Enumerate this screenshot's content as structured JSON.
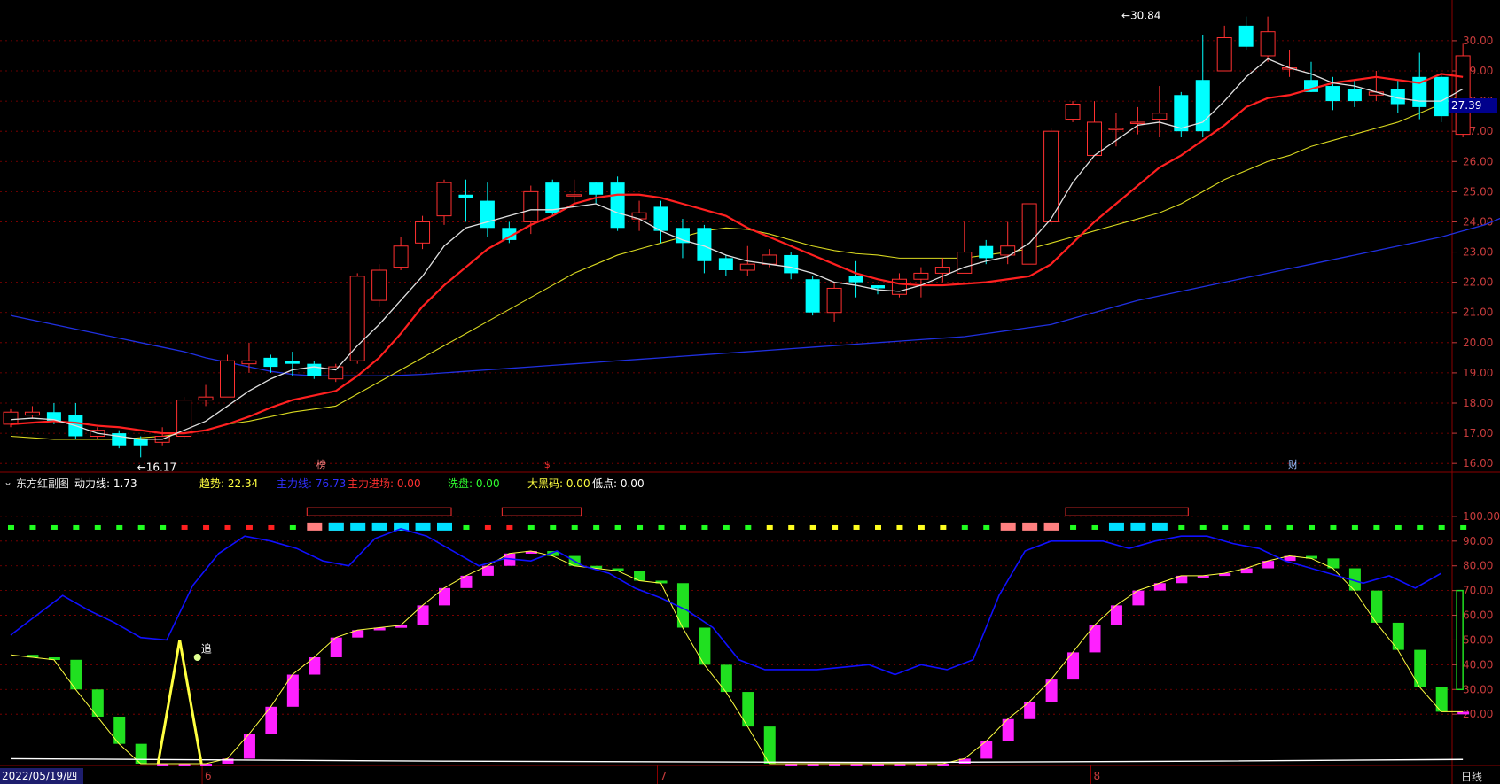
{
  "colors": {
    "up": "#ff3030",
    "down": "#00ffff",
    "ma5": "#e0e0e0",
    "ma10": "#ff2020",
    "ma20": "#d8d820",
    "ma60": "#2030e0",
    "grid": "#8b0000",
    "axis_text": "#c83c3c",
    "bar_magenta": "#ff20ff",
    "bar_green": "#20e020",
    "power_line": "#1010ff"
  },
  "chart_data": [
    {
      "type": "candlestick",
      "title": "",
      "ylim": [
        15.8,
        31.2
      ],
      "y_ticks": [
        "16.00",
        "17.00",
        "18.00",
        "19.00",
        "20.00",
        "21.00",
        "22.00",
        "23.00",
        "24.00",
        "25.00",
        "26.00",
        "27.00",
        "28.00",
        "29.00",
        "30.00"
      ],
      "month_ticks": [
        "6",
        "7",
        "8"
      ],
      "last_price": "27.39",
      "annotations": {
        "high": "30.84",
        "low": "16.17",
        "marker_top_1": "榜",
        "marker_top_2": "$",
        "marker_top_3": "财"
      },
      "candles": [
        [
          17.3,
          17.7,
          17.2,
          17.8
        ],
        [
          17.6,
          17.7,
          17.5,
          17.9
        ],
        [
          17.7,
          17.4,
          17.3,
          18.0
        ],
        [
          17.6,
          16.9,
          16.8,
          18.0
        ],
        [
          16.9,
          17.1,
          16.8,
          17.2
        ],
        [
          17.0,
          16.6,
          16.5,
          17.1
        ],
        [
          16.8,
          16.6,
          16.2,
          16.9
        ],
        [
          16.7,
          16.9,
          16.6,
          17.2
        ],
        [
          16.9,
          18.1,
          16.8,
          18.2
        ],
        [
          18.1,
          18.2,
          17.9,
          18.6
        ],
        [
          18.2,
          19.4,
          18.2,
          19.6
        ],
        [
          19.3,
          19.4,
          19.0,
          20.0
        ],
        [
          19.5,
          19.2,
          19.0,
          19.6
        ],
        [
          19.4,
          19.3,
          18.9,
          19.7
        ],
        [
          19.3,
          18.9,
          18.8,
          19.4
        ],
        [
          18.8,
          19.2,
          18.7,
          19.3
        ],
        [
          19.4,
          22.2,
          19.3,
          22.3
        ],
        [
          21.4,
          22.4,
          21.2,
          22.6
        ],
        [
          22.5,
          23.2,
          22.4,
          23.5
        ],
        [
          23.3,
          24.0,
          23.1,
          24.2
        ],
        [
          24.2,
          25.3,
          23.9,
          25.4
        ],
        [
          24.9,
          24.8,
          24.0,
          25.4
        ],
        [
          24.7,
          23.8,
          23.5,
          25.3
        ],
        [
          23.8,
          23.4,
          23.3,
          24.0
        ],
        [
          24.0,
          25.0,
          23.6,
          25.2
        ],
        [
          25.3,
          24.3,
          24.2,
          25.4
        ],
        [
          24.9,
          24.9,
          24.6,
          25.4
        ],
        [
          25.3,
          24.9,
          24.6,
          25.3
        ],
        [
          25.3,
          23.8,
          23.7,
          25.5
        ],
        [
          24.1,
          24.3,
          23.7,
          24.7
        ],
        [
          24.5,
          23.7,
          23.3,
          24.7
        ],
        [
          23.8,
          23.3,
          22.8,
          24.1
        ],
        [
          23.8,
          22.7,
          22.3,
          23.9
        ],
        [
          22.8,
          22.4,
          22.2,
          22.9
        ],
        [
          22.4,
          22.6,
          22.2,
          23.2
        ],
        [
          22.6,
          22.9,
          22.5,
          23.1
        ],
        [
          22.9,
          22.3,
          22.1,
          23.0
        ],
        [
          22.1,
          21.0,
          20.9,
          22.2
        ],
        [
          21.0,
          21.8,
          20.7,
          22.0
        ],
        [
          22.2,
          22.0,
          21.5,
          22.7
        ],
        [
          21.9,
          21.8,
          21.6,
          21.9
        ],
        [
          21.6,
          22.1,
          21.5,
          22.3
        ],
        [
          22.1,
          22.3,
          21.5,
          22.5
        ],
        [
          22.3,
          22.5,
          22.0,
          22.8
        ],
        [
          22.3,
          23.0,
          22.3,
          24.0
        ],
        [
          23.2,
          22.8,
          22.6,
          23.4
        ],
        [
          22.9,
          23.2,
          22.6,
          24.0
        ],
        [
          22.6,
          24.6,
          22.6,
          24.6
        ],
        [
          24.0,
          27.0,
          23.9,
          27.1
        ],
        [
          27.4,
          27.9,
          27.3,
          28.0
        ],
        [
          26.2,
          27.3,
          26.2,
          28.0
        ],
        [
          27.1,
          27.1,
          26.5,
          27.6
        ],
        [
          27.3,
          27.3,
          26.9,
          27.8
        ],
        [
          27.4,
          27.6,
          26.8,
          28.5
        ],
        [
          28.2,
          27.0,
          26.8,
          28.3
        ],
        [
          28.7,
          27.0,
          26.8,
          30.2
        ],
        [
          29.0,
          30.1,
          29.0,
          30.5
        ],
        [
          30.5,
          29.8,
          29.7,
          30.8
        ],
        [
          29.5,
          30.3,
          29.3,
          30.8
        ],
        [
          29.1,
          29.1,
          28.8,
          29.7
        ],
        [
          28.7,
          28.3,
          28.3,
          29.3
        ],
        [
          28.5,
          28.0,
          27.7,
          28.8
        ],
        [
          28.4,
          28.0,
          27.8,
          28.7
        ],
        [
          28.2,
          28.3,
          28.0,
          29.0
        ],
        [
          28.4,
          27.9,
          27.6,
          28.7
        ],
        [
          28.8,
          27.8,
          27.4,
          29.6
        ],
        [
          28.8,
          27.5,
          27.3,
          28.9
        ],
        [
          26.9,
          29.5,
          26.8,
          29.9
        ]
      ],
      "ma5": [
        17.45,
        17.5,
        17.45,
        17.25,
        17.0,
        16.9,
        16.8,
        16.8,
        17.1,
        17.4,
        17.9,
        18.4,
        18.8,
        19.1,
        19.2,
        19.1,
        19.9,
        20.6,
        21.4,
        22.2,
        23.2,
        23.8,
        24.0,
        24.2,
        24.4,
        24.4,
        24.5,
        24.6,
        24.3,
        24.1,
        23.7,
        23.4,
        23.2,
        22.9,
        22.7,
        22.6,
        22.5,
        22.3,
        22.0,
        21.9,
        21.75,
        21.7,
        21.9,
        22.2,
        22.5,
        22.7,
        22.85,
        23.3,
        24.1,
        25.3,
        26.2,
        26.7,
        27.2,
        27.3,
        27.1,
        27.3,
        28.0,
        28.8,
        29.4,
        29.1,
        28.9,
        28.6,
        28.5,
        28.3,
        28.1,
        28.0,
        28.0,
        28.4
      ],
      "ma10": [
        17.3,
        17.35,
        17.4,
        17.35,
        17.25,
        17.2,
        17.1,
        17.0,
        17.0,
        17.1,
        17.3,
        17.55,
        17.85,
        18.1,
        18.25,
        18.4,
        18.9,
        19.5,
        20.3,
        21.2,
        21.9,
        22.5,
        23.1,
        23.5,
        23.9,
        24.2,
        24.6,
        24.8,
        24.9,
        24.9,
        24.8,
        24.6,
        24.4,
        24.2,
        23.8,
        23.5,
        23.2,
        22.9,
        22.6,
        22.3,
        22.1,
        21.95,
        21.9,
        21.9,
        21.95,
        22.0,
        22.1,
        22.2,
        22.6,
        23.3,
        24.0,
        24.6,
        25.2,
        25.8,
        26.2,
        26.7,
        27.2,
        27.8,
        28.1,
        28.2,
        28.4,
        28.6,
        28.7,
        28.8,
        28.7,
        28.6,
        28.9,
        28.8
      ],
      "ma20": [
        16.9,
        16.85,
        16.8,
        16.8,
        16.8,
        16.8,
        16.85,
        16.9,
        17.0,
        17.1,
        17.3,
        17.4,
        17.55,
        17.7,
        17.8,
        17.9,
        18.3,
        18.7,
        19.1,
        19.5,
        19.9,
        20.3,
        20.7,
        21.1,
        21.5,
        21.9,
        22.3,
        22.6,
        22.9,
        23.1,
        23.3,
        23.5,
        23.7,
        23.8,
        23.75,
        23.6,
        23.4,
        23.2,
        23.05,
        22.95,
        22.9,
        22.8,
        22.8,
        22.8,
        22.8,
        22.9,
        23.0,
        23.1,
        23.3,
        23.5,
        23.7,
        23.9,
        24.1,
        24.3,
        24.6,
        25.0,
        25.4,
        25.7,
        26.0,
        26.2,
        26.5,
        26.7,
        26.9,
        27.1,
        27.3,
        27.6,
        27.9,
        28.2
      ],
      "ma60": [
        20.9,
        20.75,
        20.6,
        20.45,
        20.3,
        20.15,
        20.0,
        19.85,
        19.7,
        19.5,
        19.35,
        19.2,
        19.05,
        18.95,
        18.9,
        18.9,
        18.9,
        18.9,
        18.92,
        18.95,
        19.0,
        19.05,
        19.1,
        19.15,
        19.2,
        19.25,
        19.3,
        19.35,
        19.4,
        19.45,
        19.5,
        19.55,
        19.6,
        19.65,
        19.7,
        19.75,
        19.8,
        19.85,
        19.9,
        19.95,
        20.0,
        20.05,
        20.1,
        20.15,
        20.2,
        20.3,
        20.4,
        20.5,
        20.6,
        20.8,
        21.0,
        21.2,
        21.4,
        21.55,
        21.7,
        21.85,
        22.0,
        22.15,
        22.3,
        22.45,
        22.6,
        22.75,
        22.9,
        23.05,
        23.2,
        23.35,
        23.5,
        23.7,
        23.9,
        24.2
      ]
    },
    {
      "type": "indicator",
      "title": "东方红副图",
      "ylim": [
        0,
        110
      ],
      "y_ticks": [
        "20.00",
        "30.00",
        "40.00",
        "50.00",
        "60.00",
        "70.00",
        "80.00",
        "90.00",
        "100.00"
      ],
      "legend": [
        {
          "label": "动力线: 1.73",
          "color": "#ffffff"
        },
        {
          "label": "趋势: 22.34",
          "color": "#ffff40"
        },
        {
          "label": "主力线: 76.73",
          "color": "#3030ff"
        },
        {
          "label": "主力进场: 0.00",
          "color": "#ff3030"
        },
        {
          "label": "洗盘: 0.00",
          "color": "#30ff30"
        },
        {
          "label": "大黑码: 0.00",
          "color": "#ffff40"
        },
        {
          "label": "低点: 0.00",
          "color": "#ffffff"
        }
      ],
      "annotation": "追",
      "trend": [
        44,
        43,
        42,
        30,
        19,
        8,
        0,
        0,
        0,
        0,
        2,
        12,
        23,
        36,
        43,
        51,
        54,
        55,
        56,
        64,
        71,
        76,
        80,
        85,
        86,
        84,
        80,
        79,
        78,
        74,
        73,
        55,
        40,
        29,
        15,
        0,
        0,
        0,
        0,
        0,
        0,
        0,
        0,
        0,
        2,
        9,
        18,
        25,
        34,
        45,
        56,
        64,
        70,
        73,
        76,
        76,
        77,
        79,
        82,
        84,
        83,
        79,
        70,
        57,
        46,
        31,
        21,
        21
      ],
      "power": [
        52,
        60,
        68,
        62,
        57,
        51,
        50,
        72,
        85,
        92,
        90,
        87,
        82,
        80,
        91,
        95,
        92,
        86,
        80,
        83,
        82,
        86,
        80,
        77,
        71,
        67,
        62,
        55,
        42,
        38,
        38,
        38,
        39,
        40,
        36,
        40,
        38,
        42,
        68,
        86,
        90,
        90,
        90,
        87,
        90,
        92,
        92,
        89,
        87,
        82,
        79,
        76,
        73,
        76,
        71,
        77
      ],
      "flags": [
        "g",
        "g",
        "g",
        "g",
        "g",
        "g",
        "g",
        "g",
        "r",
        "r",
        "r",
        "r",
        "r",
        "g",
        "g",
        "g",
        "g",
        "g",
        "g",
        "g",
        "g",
        "g",
        "r",
        "r",
        "g",
        "g",
        "g",
        "g",
        "g",
        "g",
        "g",
        "g",
        "g",
        "g",
        "g",
        "y",
        "y",
        "y",
        "y",
        "y",
        "y",
        "y",
        "y",
        "y",
        "g",
        "g",
        "r",
        "r",
        "g",
        "g",
        "g",
        "g",
        "g",
        "g",
        "g",
        "g",
        "g",
        "g",
        "g",
        "g",
        "g",
        "g",
        "g",
        "g",
        "g",
        "g",
        "g",
        "g"
      ]
    }
  ],
  "footer": {
    "date": "2022/05/19/四",
    "period": "日线"
  }
}
